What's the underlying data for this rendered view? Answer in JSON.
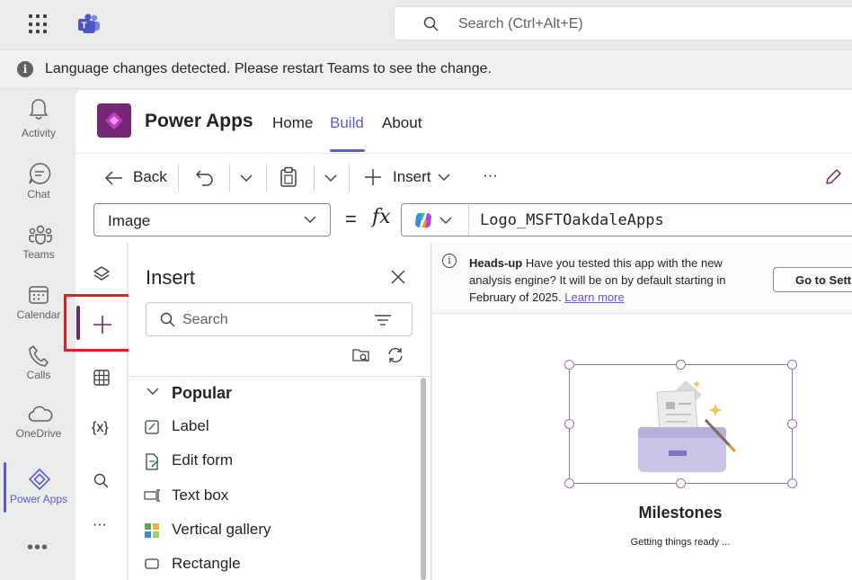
{
  "topbar": {
    "search_placeholder": "Search (Ctrl+Alt+E)"
  },
  "banner": {
    "message": "Language changes detected. Please restart Teams to see the change."
  },
  "rail": {
    "items": [
      {
        "label": "Activity",
        "icon": "bell-icon"
      },
      {
        "label": "Chat",
        "icon": "chat-icon"
      },
      {
        "label": "Teams",
        "icon": "teams-icon"
      },
      {
        "label": "Calendar",
        "icon": "calendar-icon"
      },
      {
        "label": "Calls",
        "icon": "phone-icon"
      },
      {
        "label": "OneDrive",
        "icon": "cloud-icon"
      },
      {
        "label": "Power Apps",
        "icon": "power-apps-icon",
        "active": true
      }
    ],
    "more": "•••"
  },
  "app": {
    "title": "Power Apps",
    "tabs": [
      {
        "label": "Home"
      },
      {
        "label": "Build",
        "active": true
      },
      {
        "label": "About"
      }
    ]
  },
  "toolbar": {
    "back": "Back",
    "insert": "Insert",
    "more": "···"
  },
  "formula_bar": {
    "property": "Image",
    "equals": "=",
    "fx": "fx",
    "value": "Logo_MSFTOakdaleApps"
  },
  "toolstrip": {
    "variables": "{x}",
    "more": "···"
  },
  "insert_pane": {
    "title": "Insert",
    "search_placeholder": "Search",
    "group": "Popular",
    "items": [
      {
        "label": "Label",
        "icon": "label-edit-icon"
      },
      {
        "label": "Edit form",
        "icon": "edit-form-icon"
      },
      {
        "label": "Text box",
        "icon": "text-box-icon"
      },
      {
        "label": "Vertical gallery",
        "icon": "gallery-icon"
      },
      {
        "label": "Rectangle",
        "icon": "rectangle-icon"
      }
    ]
  },
  "notice": {
    "bold": "Heads-up",
    "text": " Have you tested this app with the new analysis engine? It will be on by default starting in February of 2025. ",
    "link": "Learn more",
    "button": "Go to Settings"
  },
  "preview": {
    "title": "Milestones",
    "subtitle": "Getting things ready ..."
  },
  "colors": {
    "accent": "#5b5fc7",
    "powerapps_purple": "#742774",
    "highlight_red": "#e01e26",
    "selection": "#9b6fa8"
  }
}
